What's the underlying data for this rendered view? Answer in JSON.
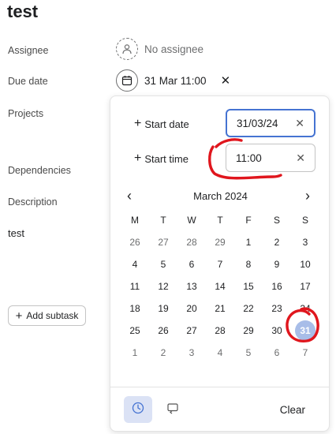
{
  "task": {
    "title": "test"
  },
  "fields": {
    "assignee_label": "Assignee",
    "assignee_value": "No assignee",
    "due_label": "Due date",
    "due_value": "31 Mar 11:00",
    "projects_label": "Projects",
    "dependencies_label": "Dependencies",
    "description_label": "Description",
    "description_value": "test"
  },
  "subtask": {
    "add_label": "Add subtask"
  },
  "picker": {
    "start_date_label": "Start date",
    "start_date_value": "31/03/24",
    "start_time_label": "Start time",
    "start_time_value": "11:00",
    "month_title": "March 2024",
    "weekdays": [
      "M",
      "T",
      "W",
      "T",
      "F",
      "S",
      "S"
    ],
    "days": [
      {
        "d": "26",
        "muted": true
      },
      {
        "d": "27",
        "muted": true
      },
      {
        "d": "28",
        "muted": true
      },
      {
        "d": "29",
        "muted": true
      },
      {
        "d": "1"
      },
      {
        "d": "2"
      },
      {
        "d": "3"
      },
      {
        "d": "4"
      },
      {
        "d": "5"
      },
      {
        "d": "6"
      },
      {
        "d": "7"
      },
      {
        "d": "8"
      },
      {
        "d": "9"
      },
      {
        "d": "10"
      },
      {
        "d": "11"
      },
      {
        "d": "12"
      },
      {
        "d": "13"
      },
      {
        "d": "14"
      },
      {
        "d": "15"
      },
      {
        "d": "16"
      },
      {
        "d": "17"
      },
      {
        "d": "18"
      },
      {
        "d": "19"
      },
      {
        "d": "20"
      },
      {
        "d": "21"
      },
      {
        "d": "22"
      },
      {
        "d": "23"
      },
      {
        "d": "24"
      },
      {
        "d": "25"
      },
      {
        "d": "26"
      },
      {
        "d": "27"
      },
      {
        "d": "28"
      },
      {
        "d": "29"
      },
      {
        "d": "30"
      },
      {
        "d": "31",
        "selected": true
      },
      {
        "d": "1",
        "muted": true
      },
      {
        "d": "2",
        "muted": true
      },
      {
        "d": "3",
        "muted": true
      },
      {
        "d": "4",
        "muted": true
      },
      {
        "d": "5",
        "muted": true
      },
      {
        "d": "6",
        "muted": true
      },
      {
        "d": "7",
        "muted": true
      }
    ],
    "clear_label": "Clear"
  },
  "colors": {
    "focus_border": "#4573d2",
    "selected_day": "#a8bde8",
    "annotation": "#e0161d"
  },
  "icons": {
    "assignee": "user-dashed-icon",
    "due": "calendar-icon",
    "clock": "clock-icon",
    "repeat": "repeat-icon"
  }
}
